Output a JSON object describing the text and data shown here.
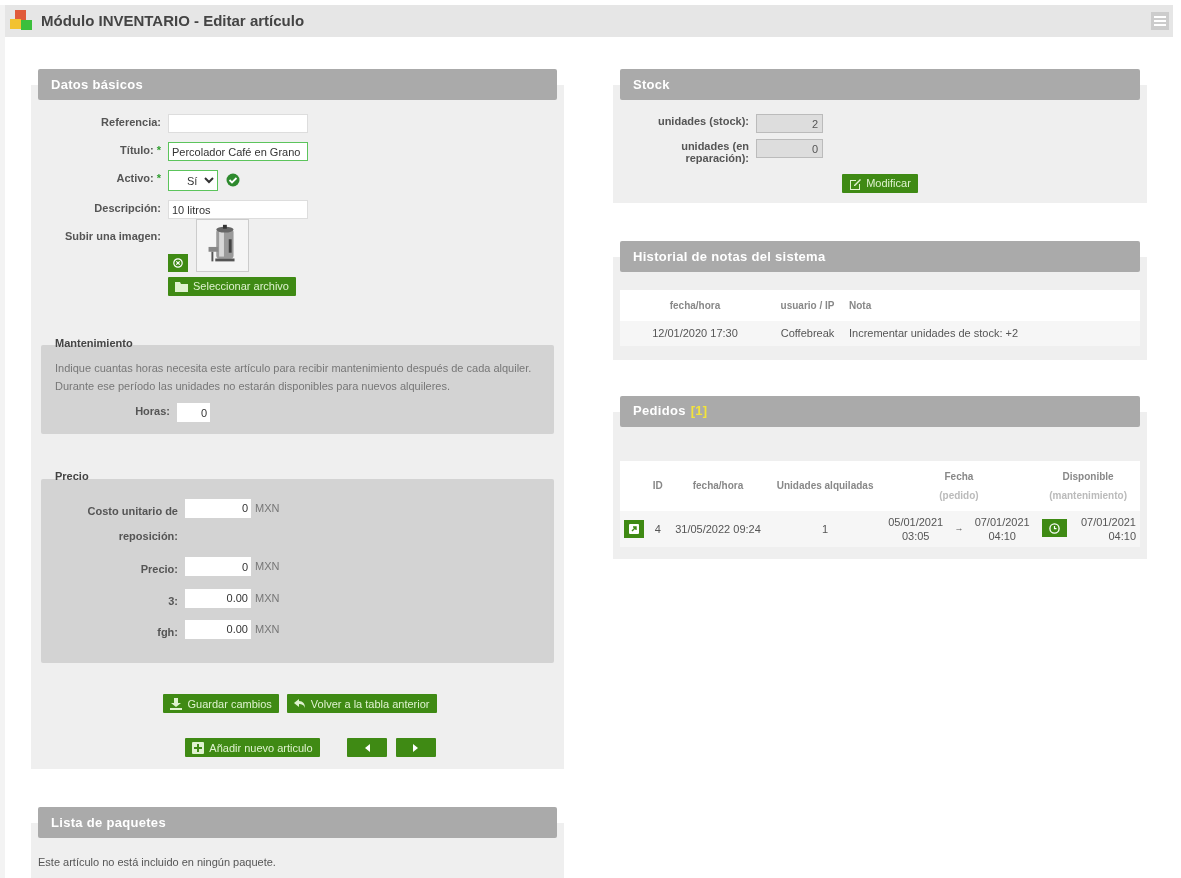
{
  "header": {
    "title": "Módulo INVENTARIO - Editar artículo"
  },
  "basic": {
    "title": "Datos básicos",
    "fields": [
      {
        "kind": "text",
        "label": "Referencia:",
        "valid": false,
        "validated": false
      },
      {
        "kind": "text",
        "label": "Título:",
        "required_mark": "*",
        "value": "Percolador Café en Grano",
        "valid": true,
        "validated": false
      },
      {
        "kind": "select",
        "label": "Activo:",
        "required_mark": "*",
        "value": "Sí",
        "valid": true,
        "validated": true
      },
      {
        "kind": "text",
        "label": "Descripción:",
        "value": "10 litros",
        "valid": false,
        "validated": false
      }
    ],
    "upload": {
      "label": "Subir una imagen:",
      "button": "Seleccionar archivo"
    },
    "maintenance": {
      "title": "Mantenimiento",
      "text": "Indique cuantas horas necesita este artículo para recibir mantenimiento después de cada alquiler. Durante ese período las unidades no estarán disponibles para nuevos alquileres.",
      "fields": [
        {
          "label": "Horas:",
          "value": "0"
        }
      ]
    },
    "price": {
      "title": "Precio",
      "fields": [
        {
          "label": "Costo unitario de reposición:",
          "value": "0",
          "unit": "MXN"
        },
        {
          "label": "Precio:",
          "value": "0",
          "unit": "MXN"
        },
        {
          "label": "3:",
          "value": "0.00",
          "unit": "MXN"
        },
        {
          "label": "fgh:",
          "value": "0.00",
          "unit": "MXN"
        }
      ]
    },
    "actions": [
      {
        "kind": "save",
        "label": "Guardar cambios"
      },
      {
        "kind": "back",
        "label": "Volver a la tabla anterior"
      }
    ],
    "nav": [
      {
        "kind": "add",
        "label": "Añadir nuevo articulo"
      },
      {
        "kind": "prev"
      },
      {
        "kind": "next"
      }
    ]
  },
  "stock": {
    "title": "Stock",
    "fields": [
      {
        "label": "unidades (stock):",
        "value": "2",
        "disabled": true
      },
      {
        "label": "unidades (en reparación):",
        "value": "0",
        "disabled": true
      }
    ],
    "button": {
      "kind": "edit",
      "label": "Modificar"
    }
  },
  "history": {
    "title": "Historial de notas del sistema",
    "columns": [
      "fecha/hora",
      "usuario / IP",
      "Nota"
    ],
    "rows": [
      [
        "12/01/2020 17:30",
        "Coffebreak",
        "Incrementar unidades de stock: +2"
      ]
    ]
  },
  "orders": {
    "title": "Pedidos",
    "count": "[1]",
    "columns": [
      {
        "label": "ID"
      },
      {
        "label": "fecha/hora"
      },
      {
        "label": "Unidades alquiladas"
      },
      {
        "label": "Fecha",
        "sublabel": "(pedido)"
      },
      {
        "label": "Disponible",
        "sublabel": "(mantenimiento)"
      }
    ],
    "rows": [
      {
        "id": "4",
        "datetime": "31/05/2022 09:24",
        "units": "1",
        "from": {
          "date": "05/01/2021",
          "time": "03:05"
        },
        "arrow": "→",
        "to": {
          "date": "07/01/2021",
          "time": "04:10"
        },
        "available": {
          "date": "07/01/2021",
          "time": "04:10"
        }
      }
    ]
  },
  "packages": {
    "title": "Lista de paquetes",
    "message": "Este artículo no está incluido en ningún paquete."
  }
}
